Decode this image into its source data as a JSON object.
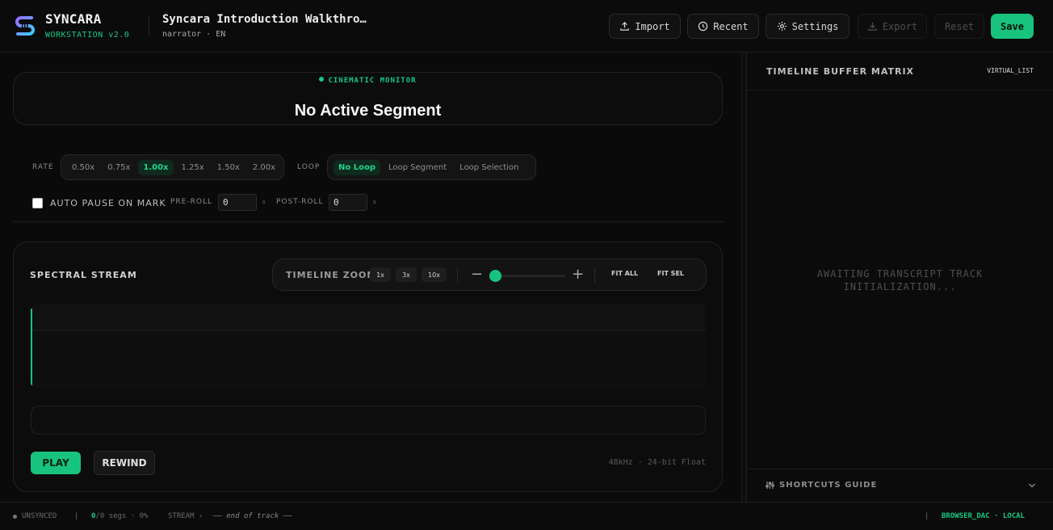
{
  "app": {
    "name": "SYNCARA",
    "version": "WORKSTATION v2.0",
    "accent": "#18c47d"
  },
  "project": {
    "title": "Syncara Introduction Walkthro…",
    "subtitle": "narrator · EN"
  },
  "toolbar": {
    "import_label": "Import",
    "recent_label": "Recent",
    "settings_label": "Settings",
    "export_label": "Export",
    "reset_label": "Reset",
    "save_label": "Save"
  },
  "monitor": {
    "label": "CINEMATIC MONITOR",
    "title": "No Active Segment"
  },
  "controls": {
    "rate_label": "RATE",
    "rates": [
      "0.50x",
      "0.75x",
      "1.00x",
      "1.25x",
      "1.50x",
      "2.00x"
    ],
    "rate_selected": "1.00x",
    "loop_label": "LOOP",
    "loops": [
      "No Loop",
      "Loop Segment",
      "Loop Selection"
    ],
    "loop_selected": "No Loop",
    "auto_pause_label": "AUTO PAUSE ON MARK",
    "auto_pause_checked": false,
    "preroll_label": "PRE-ROLL",
    "preroll_value": "0",
    "preroll_unit": "s",
    "postroll_label": "POST-ROLL",
    "postroll_value": "0",
    "postroll_unit": "s"
  },
  "spectral": {
    "title": "SPECTRAL STREAM",
    "zoom_label": "TIMELINE ZOOM",
    "zoom_presets": [
      "1x",
      "3x",
      "10x"
    ],
    "zoom_level": 0.0,
    "minus": "−",
    "plus": "+",
    "fit_all": "FIT ALL",
    "fit_sel": "FIT SEL",
    "play_label": "PLAY",
    "rewind_label": "REWIND",
    "format": "48kHz · 24-bit Float"
  },
  "buffer": {
    "title": "TIMELINE BUFFER MATRIX",
    "tag": "VIRTUAL_LIST",
    "empty_line1": "AWAITING TRANSCRIPT TRACK",
    "empty_line2": "INITIALIZATION...",
    "shortcuts_label": "SHORTCUTS GUIDE"
  },
  "status": {
    "sync": "UNSYNCED",
    "sep": "|",
    "seg_count": "0",
    "seg_text": "/0 segs · 0%",
    "stream": "STREAM ›",
    "track": "—— end of track ——",
    "engine": "BROWSER_DAC · LOCAL"
  }
}
